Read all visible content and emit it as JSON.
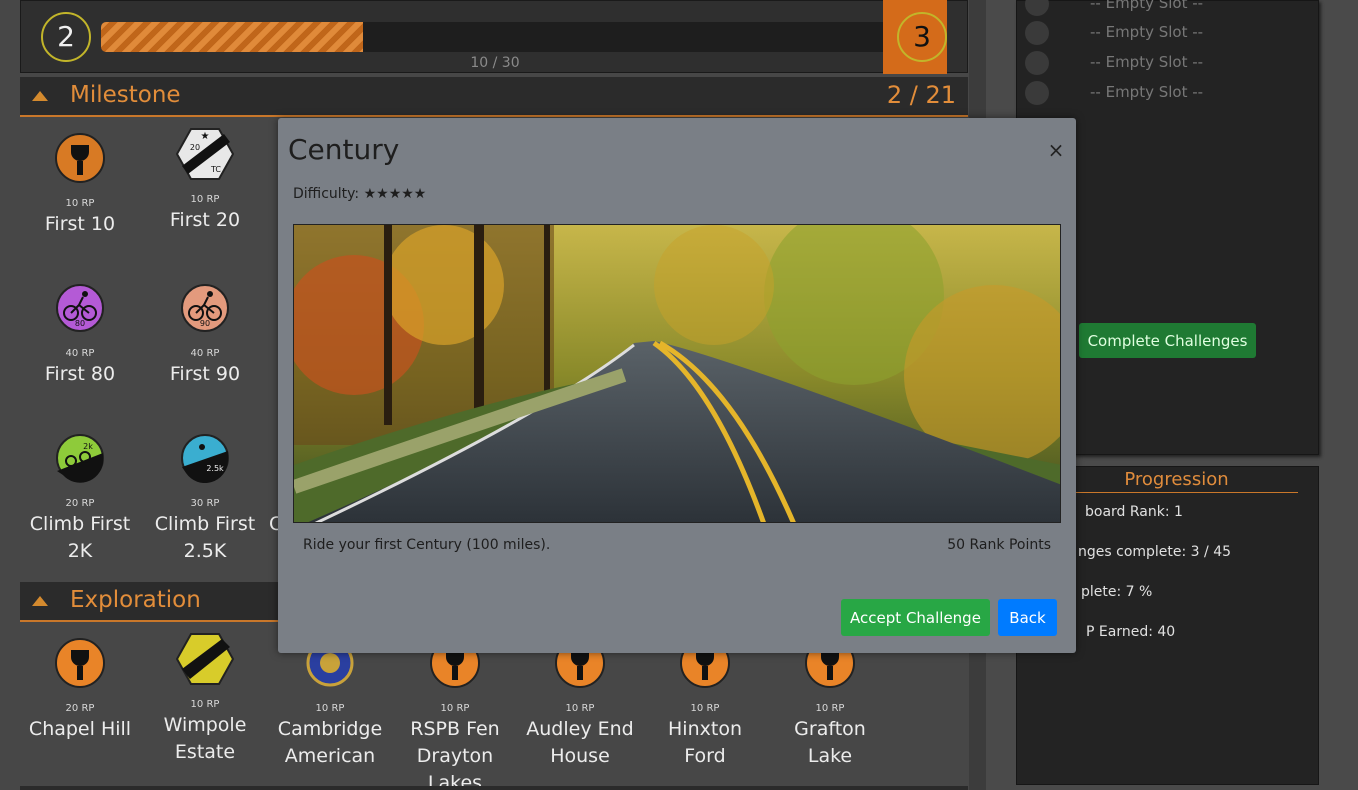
{
  "level": {
    "current": "2",
    "next": "3",
    "progress_text": "10 / 30",
    "progress_fraction": 0.333
  },
  "milestone": {
    "title": "Milestone",
    "count": "2 / 21",
    "badges": [
      {
        "rp": "10 RP",
        "name": "First 10"
      },
      {
        "rp": "10 RP",
        "name": "First 20"
      },
      {
        "rp": "40 RP",
        "name": "First 80"
      },
      {
        "rp": "40 RP",
        "name": "First 90"
      },
      {
        "rp": "20 RP",
        "name": "Climb First 2K"
      },
      {
        "rp": "30 RP",
        "name": "Climb First 2.5K"
      }
    ],
    "badge_icon_text": {
      "b2_top": "20",
      "b2_bot": "TC",
      "b3": "80",
      "b4": "90",
      "b5": "2k",
      "b6": "2.5k"
    },
    "partial_name": "C"
  },
  "exploration": {
    "title": "Exploration",
    "badges": [
      {
        "rp": "20 RP",
        "name": "Chapel Hill"
      },
      {
        "rp": "10 RP",
        "name": "Wimpole Estate"
      },
      {
        "rp": "10 RP",
        "name": "Cambridge American"
      },
      {
        "rp": "10 RP",
        "name": "RSPB Fen Drayton Lakes"
      },
      {
        "rp": "10 RP",
        "name": "Audley End House"
      },
      {
        "rp": "10 RP",
        "name": "Hinxton Ford"
      },
      {
        "rp": "10 RP",
        "name": "Grafton Lake"
      }
    ]
  },
  "slots": {
    "items": [
      "-- Empty Slot --",
      "-- Empty Slot --",
      "-- Empty Slot --",
      "-- Empty Slot --"
    ],
    "complete_label": "Complete Challenges"
  },
  "progression": {
    "title": "Progression",
    "lines": [
      "board Rank: 1",
      "nges complete: 3 / 45",
      "plete: 7 %",
      "P Earned: 40"
    ]
  },
  "modal": {
    "title": "Century",
    "close": "×",
    "difficulty": "Difficulty: ★★★★★",
    "description": "Ride your first Century (100 miles).",
    "points": "50 Rank Points",
    "accept_label": "Accept Challenge",
    "back_label": "Back"
  }
}
